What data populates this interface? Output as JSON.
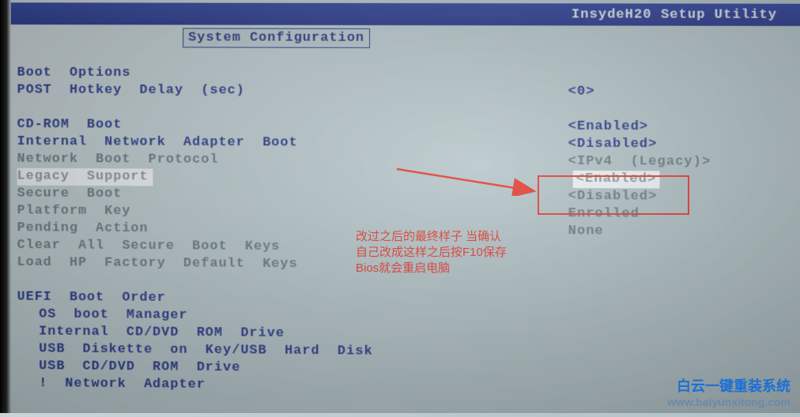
{
  "header": {
    "utility": "InsydeH20  Setup  Utility",
    "tab": "System  Configuration"
  },
  "sections": {
    "boot_options": "Boot  Options",
    "post_hotkey": {
      "label": "POST  Hotkey  Delay  (sec)",
      "value": "<0>"
    },
    "cdrom": {
      "label": "CD-ROM  Boot",
      "value": "<Enabled>"
    },
    "intnet": {
      "label": "Internal  Network  Adapter  Boot",
      "value": "<Disabled>"
    },
    "netproto": {
      "label": "Network  Boot  Protocol",
      "value": "<IPv4  (Legacy)>"
    },
    "legacy": {
      "label": "Legacy  Support",
      "value": "<Enabled>"
    },
    "secure": {
      "label": "Secure  Boot",
      "value": "<Disabled>"
    },
    "platkey": {
      "label": "Platform  Key",
      "value": "Enrolled"
    },
    "pending": {
      "label": "Pending  Action",
      "value": "None"
    },
    "clearkeys": {
      "label": "Clear  All  Secure  Boot  Keys"
    },
    "loadhp": {
      "label": "Load  HP  Factory  Default  Keys"
    },
    "uefi_order": "UEFI  Boot  Order",
    "uefi": {
      "os_mgr": "OS  boot  Manager",
      "int_dvd": "Internal  CD/DVD  ROM  Drive",
      "usb_disk": "USB  Diskette  on  Key/USB  Hard  Disk",
      "usb_dvd": "USB  CD/DVD  ROM  Drive",
      "net": "!  Network  Adapter"
    }
  },
  "annotation": {
    "l1": "改过之后的最终样子 当确认",
    "l2": "自己改成这样之后按F10保存",
    "l3": "Bios就会重启电脑"
  },
  "watermark": {
    "title": "白云一键重装系统",
    "url": "www.baiyunxitong.com"
  }
}
